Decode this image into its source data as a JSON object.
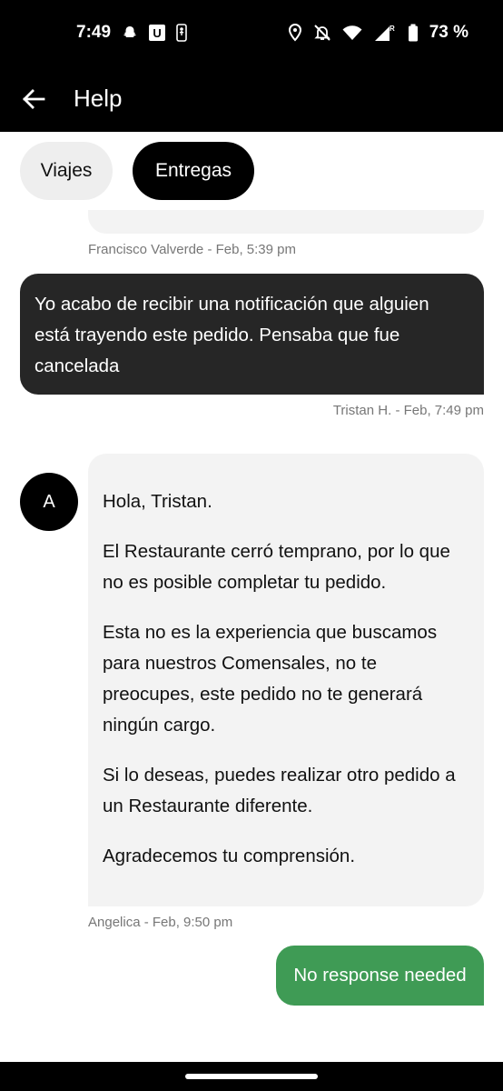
{
  "status_bar": {
    "time": "7:49",
    "app_icons": [
      "snapchat-icon",
      "u-app-icon",
      "nba-icon"
    ],
    "u_badge": "U",
    "battery_percent": "73 %",
    "icons": [
      "location-icon",
      "bell-off-icon",
      "wifi-icon",
      "signal-icon",
      "battery-icon"
    ],
    "roaming_mark": "R"
  },
  "app_bar": {
    "back_icon": "arrow-left-icon",
    "title": "Help"
  },
  "tabs": [
    {
      "label": "Viajes",
      "active": false
    },
    {
      "label": "Entregas",
      "active": true
    }
  ],
  "messages": {
    "clipped_meta": "Francisco Valverde - Feb, 5:39 pm",
    "user_message": "Yo acabo de recibir una notificación que alguien está trayendo este pedido. Pensaba que fue cancelada",
    "user_meta": "Tristan H. - Feb, 7:49 pm",
    "agent_avatar": "A",
    "agent_paragraphs": [
      "Hola, Tristan.",
      "El Restaurante cerró temprano, por lo que no es posible completar tu pedido.",
      "Esta no es la experiencia que buscamos para nuestros Comensales, no te preocupes, este pedido no te generará ningún cargo.",
      "Si lo deseas, puedes realizar otro pedido a un Restaurante diferente.",
      "Agradecemos tu comprensión."
    ],
    "agent_meta": "Angelica - Feb, 9:50 pm"
  },
  "reply": {
    "label": "No response needed"
  },
  "colors": {
    "header_bg": "#000000",
    "user_bubble": "#262626",
    "agent_bubble": "#f3f3f3",
    "reply_green": "#3f9b55",
    "meta_text": "#777777"
  }
}
